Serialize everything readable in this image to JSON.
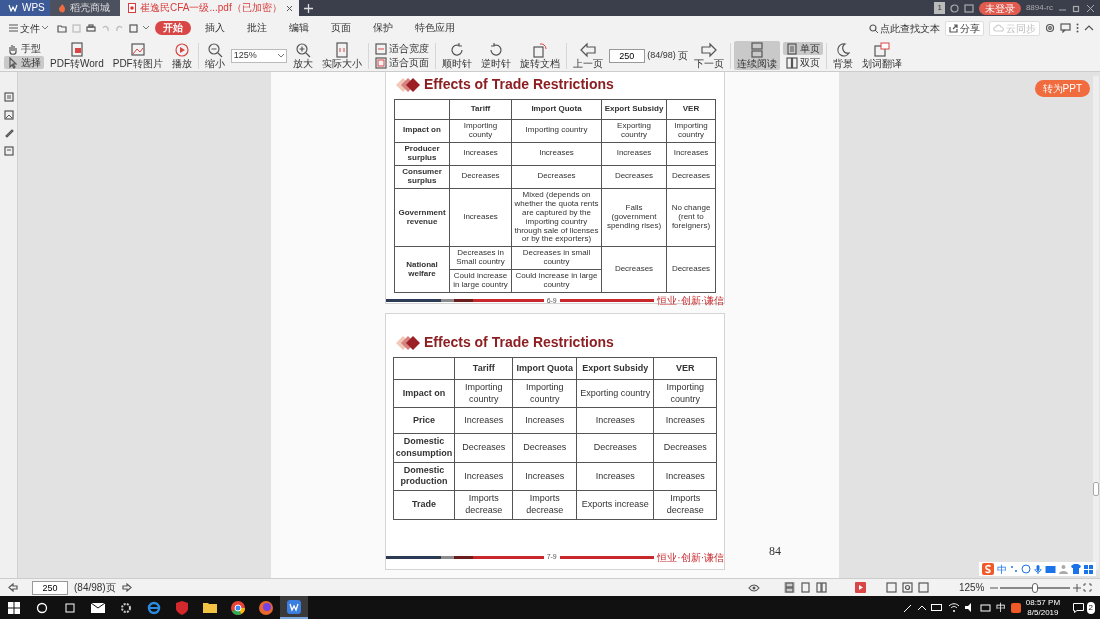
{
  "title_bar": {
    "tabs": [
      {
        "label": "WPS",
        "kind": "home",
        "selected": false
      },
      {
        "label": "稻壳商城",
        "kind": "store",
        "selected": false
      },
      {
        "label": "崔逸民CFA一级...pdf（已加密）",
        "kind": "doc",
        "selected": true
      }
    ],
    "badge": "1",
    "login": "未登录",
    "user": "8894-rc"
  },
  "menu": {
    "file": "文件",
    "tabs": [
      {
        "label": "开始",
        "selected": true
      },
      {
        "label": "插入",
        "selected": false
      },
      {
        "label": "批注",
        "selected": false
      },
      {
        "label": "编辑",
        "selected": false
      },
      {
        "label": "页面",
        "selected": false
      },
      {
        "label": "保护",
        "selected": false
      },
      {
        "label": "特色应用",
        "selected": false
      }
    ],
    "search": "点此查找文本",
    "share": "分享",
    "sync": "云同步"
  },
  "toolbar": [
    {
      "kind": "stack",
      "items": [
        {
          "label": "手型",
          "selected": false
        },
        {
          "label": "选择",
          "selected": true
        }
      ]
    },
    {
      "kind": "big",
      "label": "PDF转Word"
    },
    {
      "kind": "big",
      "label": "PDF转图片"
    },
    {
      "kind": "big",
      "label": "播放"
    },
    {
      "kind": "big",
      "label": "缩小"
    },
    {
      "kind": "zoom",
      "value": "125%"
    },
    {
      "kind": "big",
      "label": "放大"
    },
    {
      "kind": "big",
      "label": "实际大小"
    },
    {
      "kind": "stack",
      "items": [
        {
          "label": "适合宽度",
          "selected": false
        },
        {
          "label": "适合页面",
          "selected": false
        }
      ]
    },
    {
      "kind": "big",
      "label": "顺时针"
    },
    {
      "kind": "big",
      "label": "逆时针"
    },
    {
      "kind": "big",
      "label": "旋转文档"
    },
    {
      "kind": "big",
      "label": "上一页"
    },
    {
      "kind": "page",
      "value": "250",
      "total": "(84/98)",
      "unit": "页"
    },
    {
      "kind": "big",
      "label": "下一页"
    },
    {
      "kind": "big",
      "label": "连续阅读",
      "selected": true
    },
    {
      "kind": "stack",
      "items": [
        {
          "label": "单页",
          "selected": true
        },
        {
          "label": "双页",
          "selected": false
        }
      ]
    },
    {
      "kind": "big",
      "label": "背景"
    },
    {
      "kind": "big",
      "label": "划词翻译"
    }
  ],
  "float_button": "转为PPT",
  "pages": [
    {
      "title": "Effects of Trade Restrictions",
      "columns": [
        "Tariff",
        "Import Quota",
        "Export Subsidy",
        "VER"
      ],
      "rows": [
        {
          "label": "Impact on",
          "cells": [
            "Importing county",
            "Importing country",
            "Exporting country",
            "Importing country"
          ]
        },
        {
          "label": "Producer surplus",
          "cells": [
            "Increases",
            "Increases",
            "Increases",
            "Increases"
          ]
        },
        {
          "label": "Consumer surplus",
          "cells": [
            "Decreases",
            "Decreases",
            "Decreases",
            "Decreases"
          ]
        },
        {
          "label": "Government revenue",
          "cells": [
            "Increases",
            "Mixed (depends on whether the quota rents are captured by the importing country through sale of licenses or by the exporters)",
            "Falls (government spending rises)",
            "No change (rent to foreigners)"
          ]
        },
        {
          "label": "National welfare",
          "cells": [
            [
              "Decreases in Small country",
              "Could increase in large country"
            ],
            [
              "Decreases in small country",
              "Could increase in large country"
            ],
            "Decreases",
            "Decreases"
          ]
        }
      ],
      "page_label": "6-9",
      "footer": "恒业·创新·谦信"
    },
    {
      "title": "Effects of Trade Restrictions",
      "columns": [
        "Tariff",
        "Import Quota",
        "Export Subsidy",
        "VER"
      ],
      "rows": [
        {
          "label": "Impact on",
          "cells": [
            "Importing country",
            "Importing country",
            "Exporting country",
            "Importing country"
          ]
        },
        {
          "label": "Price",
          "cells": [
            "Increases",
            "Increases",
            "Increases",
            "Increases"
          ]
        },
        {
          "label": "Domestic consumption",
          "cells": [
            "Decreases",
            "Decreases",
            "Decreases",
            "Decreases"
          ]
        },
        {
          "label": "Domestic production",
          "cells": [
            "Increases",
            "Increases",
            "Increases",
            "Increases"
          ]
        },
        {
          "label": "Trade",
          "cells": [
            "Imports decrease",
            "Imports decrease",
            "Exports increase",
            "Imports decrease"
          ]
        }
      ],
      "page_label": "7-9",
      "footer": "恒业·创新·谦信",
      "page_number": "84"
    }
  ],
  "status_bar": {
    "page": "250",
    "count": "(84/98)页",
    "zoom": "125%",
    "zoom_slider": {
      "level": 0.5
    }
  },
  "ime_bar": {
    "mode": "中"
  },
  "taskbar": {
    "ime": "中",
    "time": "08:57 PM",
    "date": "8/5/2019",
    "notifications": "2"
  }
}
